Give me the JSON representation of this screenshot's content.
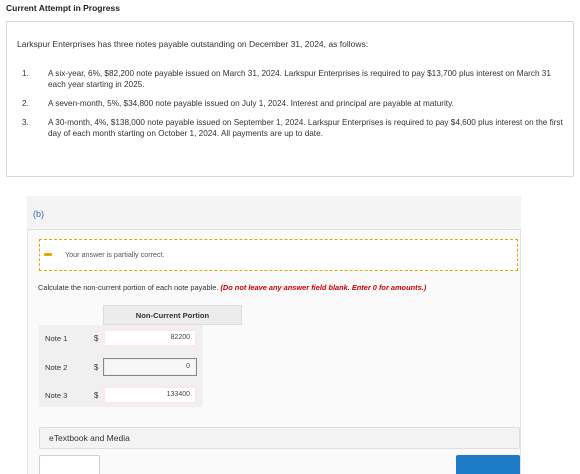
{
  "header": {
    "title": "Current Attempt in Progress"
  },
  "problem": {
    "intro": "Larkspur Enterprises has three notes payable outstanding on December 31, 2024, as follows:",
    "notes": [
      {
        "num": "1.",
        "text": "A six-year, 6%, $82,200 note payable issued on March 31, 2024. Larkspur Enterprises is required to pay $13,700 plus interest on March 31 each year starting in 2025."
      },
      {
        "num": "2.",
        "text": "A seven-month, 5%, $34,800 note payable issued on July 1, 2024. Interest and principal are payable at maturity."
      },
      {
        "num": "3.",
        "text": "A 30-month, 4%, $138,000 note payable issued on September 1, 2024. Larkspur Enterprises is required to pay $4,600 plus interest on the first day of each month starting on October 1, 2024. All payments are up to date."
      }
    ]
  },
  "part": {
    "label": "(b)",
    "alert": "Your answer is partially correct.",
    "instruction_main": "Calculate the non-current portion of each note payable.",
    "instruction_warn": "(Do not leave any answer field blank. Enter 0 for amounts.)",
    "table": {
      "column_header": "Non-Current Portion",
      "currency": "$",
      "rows": [
        {
          "label": "Note 1",
          "value": "82200",
          "status": "incorrect"
        },
        {
          "label": "Note 2",
          "value": "0",
          "status": "correct"
        },
        {
          "label": "Note 3",
          "value": "133400",
          "status": "incorrect"
        }
      ]
    }
  },
  "resources": {
    "etextbook_label": "eTextbook and Media"
  },
  "colors": {
    "part_label": "#2b6cb0",
    "alert_border": "#e0a800",
    "warn_text": "#cc0000",
    "incorrect_border": "#c0392b",
    "primary_button": "#1e7bc8"
  }
}
